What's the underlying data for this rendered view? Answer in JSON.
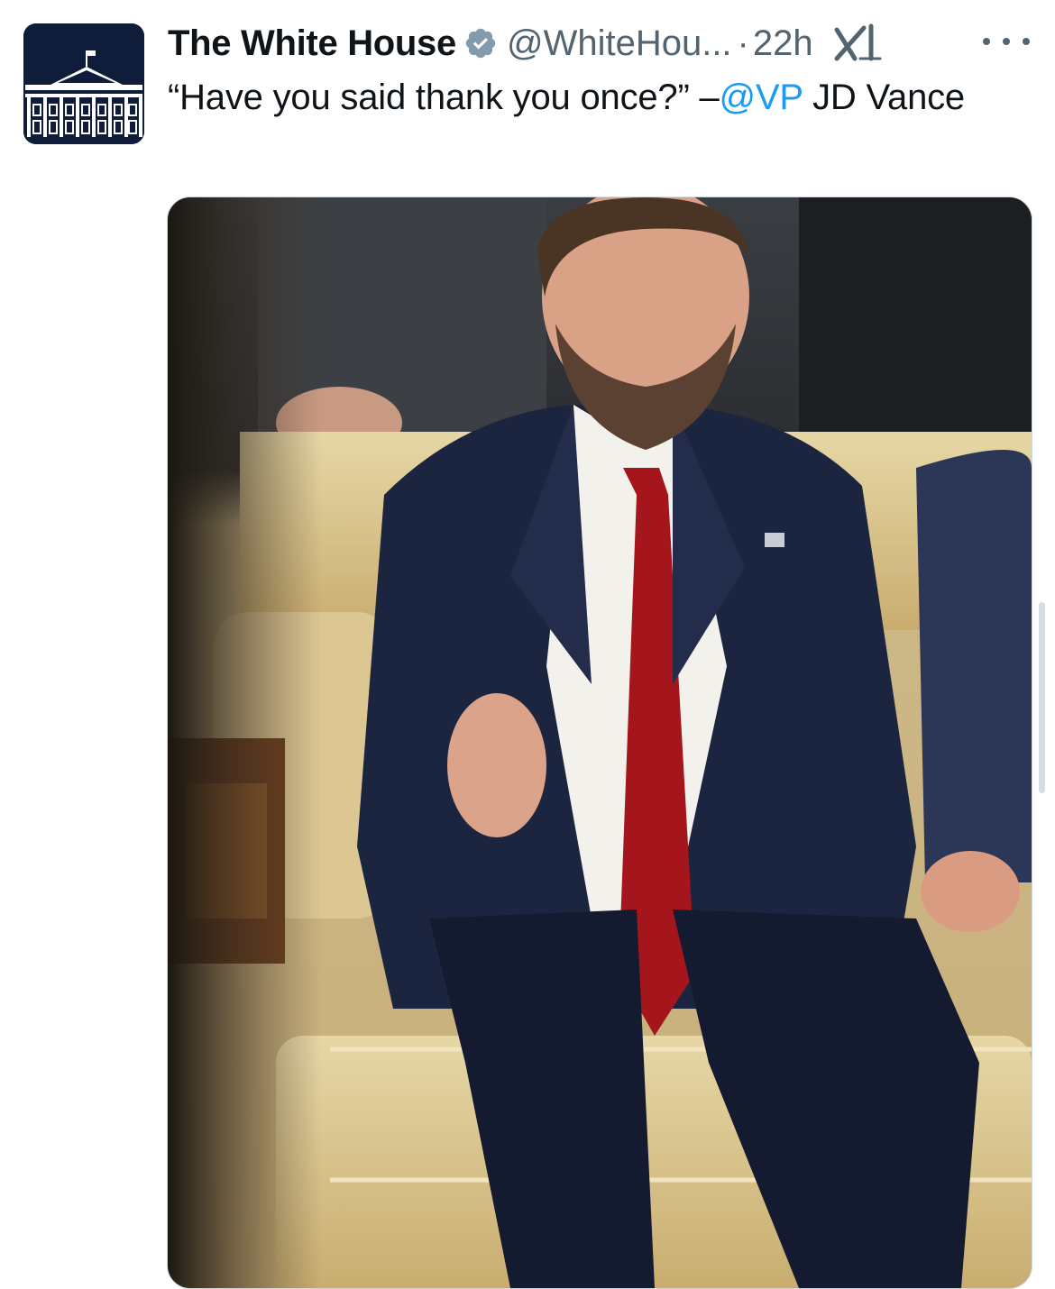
{
  "tweet": {
    "author": {
      "display_name": "The White House",
      "verified": true,
      "verified_badge_color": "#829aab",
      "handle": "@WhiteHou...",
      "separator": "·",
      "timestamp": "22h"
    },
    "text_prefix": "“Have you said thank you once?” –",
    "mention": "@VP",
    "text_suffix": " JD Vance",
    "media_alt": ""
  },
  "colors": {
    "text_primary": "#0f1419",
    "text_secondary": "#536471",
    "link": "#1d9bf0",
    "avatar_bg": "#0f1d3a",
    "suit_navy": "#1c2540",
    "tie_red": "#a5161c",
    "chair_gold": "#d9c48f"
  },
  "icons": {
    "verified": "verified-badge-icon",
    "grok": "grok-icon",
    "more": "more-options-icon"
  }
}
